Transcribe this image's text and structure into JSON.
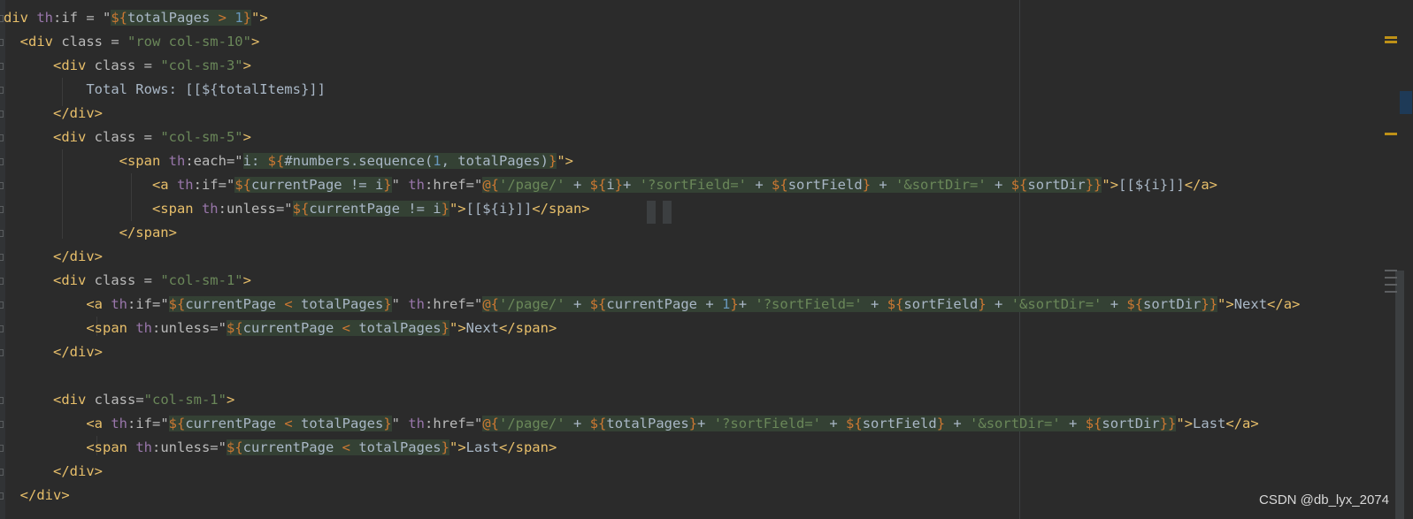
{
  "editor": {
    "lines": [
      [
        {
          "t": "div ",
          "c": "tag"
        },
        {
          "t": "th",
          "c": "ns"
        },
        {
          "t": ":if = \"",
          "c": "attr"
        },
        {
          "t": "${",
          "c": "expr",
          "h": 1
        },
        {
          "t": "totalPages ",
          "c": "txt",
          "h": 1
        },
        {
          "t": "> ",
          "c": "expr",
          "h": 1
        },
        {
          "t": "1",
          "c": "num",
          "h": 1
        },
        {
          "t": "}",
          "c": "expr",
          "h": 1
        },
        {
          "t": "\">",
          "c": "tag"
        }
      ],
      [
        {
          "t": "  <div ",
          "c": "tag"
        },
        {
          "t": "class = ",
          "c": "attr"
        },
        {
          "t": "\"row col-sm-10\"",
          "c": "str"
        },
        {
          "t": ">",
          "c": "tag"
        }
      ],
      [
        {
          "t": "      <div ",
          "c": "tag"
        },
        {
          "t": "class = ",
          "c": "attr"
        },
        {
          "t": "\"col-sm-3\"",
          "c": "str"
        },
        {
          "t": ">",
          "c": "tag"
        }
      ],
      [
        {
          "t": "          Total Rows: [[${totalItems}]]",
          "c": "txt"
        }
      ],
      [
        {
          "t": "      </div>",
          "c": "tag"
        }
      ],
      [
        {
          "t": "      <div ",
          "c": "tag"
        },
        {
          "t": "class = ",
          "c": "attr"
        },
        {
          "t": "\"col-sm-5\"",
          "c": "str"
        },
        {
          "t": ">",
          "c": "tag"
        }
      ],
      [
        {
          "t": "              <span ",
          "c": "tag"
        },
        {
          "t": "th",
          "c": "ns"
        },
        {
          "t": ":each=\"",
          "c": "attr"
        },
        {
          "t": "i: ",
          "c": "txt",
          "h": 1
        },
        {
          "t": "${",
          "c": "expr",
          "h": 1
        },
        {
          "t": "#numbers.sequence(",
          "c": "txt",
          "h": 1
        },
        {
          "t": "1",
          "c": "num",
          "h": 1
        },
        {
          "t": ", totalPages)",
          "c": "txt",
          "h": 1
        },
        {
          "t": "}",
          "c": "expr",
          "h": 1
        },
        {
          "t": "\">",
          "c": "tag"
        }
      ],
      [
        {
          "t": "                  <a ",
          "c": "tag"
        },
        {
          "t": "th",
          "c": "ns"
        },
        {
          "t": ":if=\"",
          "c": "attr"
        },
        {
          "t": "${",
          "c": "expr",
          "h": 1
        },
        {
          "t": "currentPage != i",
          "c": "txt",
          "h": 1
        },
        {
          "t": "}",
          "c": "expr",
          "h": 1
        },
        {
          "t": "\" ",
          "c": "attr"
        },
        {
          "t": "th",
          "c": "ns"
        },
        {
          "t": ":href=\"",
          "c": "attr"
        },
        {
          "t": "@{",
          "c": "expr",
          "h": 1
        },
        {
          "t": "'/page/' ",
          "c": "str",
          "h": 1
        },
        {
          "t": "+ ",
          "c": "txt",
          "h": 1
        },
        {
          "t": "${",
          "c": "expr",
          "h": 1
        },
        {
          "t": "i",
          "c": "txt",
          "h": 1
        },
        {
          "t": "}",
          "c": "expr",
          "h": 1
        },
        {
          "t": "+ ",
          "c": "txt",
          "h": 1
        },
        {
          "t": "'?sortField=' ",
          "c": "str",
          "h": 1
        },
        {
          "t": "+ ",
          "c": "txt",
          "h": 1
        },
        {
          "t": "${",
          "c": "expr",
          "h": 1
        },
        {
          "t": "sortField",
          "c": "txt",
          "h": 1
        },
        {
          "t": "} ",
          "c": "expr",
          "h": 1
        },
        {
          "t": "+ ",
          "c": "txt",
          "h": 1
        },
        {
          "t": "'&sortDir=' ",
          "c": "str",
          "h": 1
        },
        {
          "t": "+ ",
          "c": "txt",
          "h": 1
        },
        {
          "t": "${",
          "c": "expr",
          "h": 1
        },
        {
          "t": "sortDir",
          "c": "txt",
          "h": 1
        },
        {
          "t": "}}",
          "c": "expr",
          "h": 1
        },
        {
          "t": "\">",
          "c": "tag"
        },
        {
          "t": "[[${i}]]",
          "c": "txt"
        },
        {
          "t": "</a>",
          "c": "tag"
        }
      ],
      [
        {
          "t": "                  <span ",
          "c": "tag"
        },
        {
          "t": "th",
          "c": "ns"
        },
        {
          "t": ":unless=\"",
          "c": "attr"
        },
        {
          "t": "${",
          "c": "expr",
          "h": 1
        },
        {
          "t": "currentPage != i",
          "c": "txt",
          "h": 1
        },
        {
          "t": "}",
          "c": "expr",
          "h": 1
        },
        {
          "t": "\">",
          "c": "tag"
        },
        {
          "t": "[[${i}]]",
          "c": "txt"
        },
        {
          "t": "</span>",
          "c": "tag"
        }
      ],
      [
        {
          "t": "              </span>",
          "c": "tag"
        }
      ],
      [
        {
          "t": "      </div>",
          "c": "tag"
        }
      ],
      [
        {
          "t": "      <div ",
          "c": "tag"
        },
        {
          "t": "class = ",
          "c": "attr"
        },
        {
          "t": "\"col-sm-1\"",
          "c": "str"
        },
        {
          "t": ">",
          "c": "tag"
        }
      ],
      [
        {
          "t": "          <a ",
          "c": "tag"
        },
        {
          "t": "th",
          "c": "ns"
        },
        {
          "t": ":if=\"",
          "c": "attr"
        },
        {
          "t": "${",
          "c": "expr",
          "h": 1
        },
        {
          "t": "currentPage ",
          "c": "txt",
          "h": 1
        },
        {
          "t": "< ",
          "c": "expr",
          "h": 1
        },
        {
          "t": "totalPages",
          "c": "txt",
          "h": 1
        },
        {
          "t": "}",
          "c": "expr",
          "h": 1
        },
        {
          "t": "\" ",
          "c": "attr"
        },
        {
          "t": "th",
          "c": "ns"
        },
        {
          "t": ":href=\"",
          "c": "attr"
        },
        {
          "t": "@{",
          "c": "expr",
          "h": 1
        },
        {
          "t": "'/page/' ",
          "c": "str",
          "h": 1
        },
        {
          "t": "+ ",
          "c": "txt",
          "h": 1
        },
        {
          "t": "${",
          "c": "expr",
          "h": 1
        },
        {
          "t": "currentPage ",
          "c": "txt",
          "h": 1
        },
        {
          "t": "+ ",
          "c": "txt",
          "h": 1
        },
        {
          "t": "1",
          "c": "num",
          "h": 1
        },
        {
          "t": "}",
          "c": "expr",
          "h": 1
        },
        {
          "t": "+ ",
          "c": "txt",
          "h": 1
        },
        {
          "t": "'?sortField=' ",
          "c": "str",
          "h": 1
        },
        {
          "t": "+ ",
          "c": "txt",
          "h": 1
        },
        {
          "t": "${",
          "c": "expr",
          "h": 1
        },
        {
          "t": "sortField",
          "c": "txt",
          "h": 1
        },
        {
          "t": "} ",
          "c": "expr",
          "h": 1
        },
        {
          "t": "+ ",
          "c": "txt",
          "h": 1
        },
        {
          "t": "'&sortDir=' ",
          "c": "str",
          "h": 1
        },
        {
          "t": "+ ",
          "c": "txt",
          "h": 1
        },
        {
          "t": "${",
          "c": "expr",
          "h": 1
        },
        {
          "t": "sortDir",
          "c": "txt",
          "h": 1
        },
        {
          "t": "}}",
          "c": "expr",
          "h": 1
        },
        {
          "t": "\">",
          "c": "tag"
        },
        {
          "t": "Next",
          "c": "txt"
        },
        {
          "t": "</a>",
          "c": "tag"
        }
      ],
      [
        {
          "t": "          <span ",
          "c": "tag"
        },
        {
          "t": "th",
          "c": "ns"
        },
        {
          "t": ":unless=\"",
          "c": "attr"
        },
        {
          "t": "${",
          "c": "expr",
          "h": 1
        },
        {
          "t": "currentPage ",
          "c": "txt",
          "h": 1
        },
        {
          "t": "< ",
          "c": "expr",
          "h": 1
        },
        {
          "t": "totalPages",
          "c": "txt",
          "h": 1
        },
        {
          "t": "}",
          "c": "expr",
          "h": 1
        },
        {
          "t": "\">",
          "c": "tag"
        },
        {
          "t": "Next",
          "c": "txt"
        },
        {
          "t": "</span>",
          "c": "tag"
        }
      ],
      [
        {
          "t": "      </div>",
          "c": "tag"
        }
      ],
      [],
      [
        {
          "t": "      <div ",
          "c": "tag"
        },
        {
          "t": "class=",
          "c": "attr"
        },
        {
          "t": "\"col-sm-1\"",
          "c": "str"
        },
        {
          "t": ">",
          "c": "tag"
        }
      ],
      [
        {
          "t": "          <a ",
          "c": "tag"
        },
        {
          "t": "th",
          "c": "ns"
        },
        {
          "t": ":if=\"",
          "c": "attr"
        },
        {
          "t": "${",
          "c": "expr",
          "h": 1
        },
        {
          "t": "currentPage ",
          "c": "txt",
          "h": 1
        },
        {
          "t": "< ",
          "c": "expr",
          "h": 1
        },
        {
          "t": "totalPages",
          "c": "txt",
          "h": 1
        },
        {
          "t": "}",
          "c": "expr",
          "h": 1
        },
        {
          "t": "\" ",
          "c": "attr"
        },
        {
          "t": "th",
          "c": "ns"
        },
        {
          "t": ":href=\"",
          "c": "attr"
        },
        {
          "t": "@{",
          "c": "expr",
          "h": 1
        },
        {
          "t": "'/page/' ",
          "c": "str",
          "h": 1
        },
        {
          "t": "+ ",
          "c": "txt",
          "h": 1
        },
        {
          "t": "${",
          "c": "expr",
          "h": 1
        },
        {
          "t": "totalPages",
          "c": "txt",
          "h": 1
        },
        {
          "t": "}",
          "c": "expr",
          "h": 1
        },
        {
          "t": "+ ",
          "c": "txt",
          "h": 1
        },
        {
          "t": "'?sortField=' ",
          "c": "str",
          "h": 1
        },
        {
          "t": "+ ",
          "c": "txt",
          "h": 1
        },
        {
          "t": "${",
          "c": "expr",
          "h": 1
        },
        {
          "t": "sortField",
          "c": "txt",
          "h": 1
        },
        {
          "t": "} ",
          "c": "expr",
          "h": 1
        },
        {
          "t": "+ ",
          "c": "txt",
          "h": 1
        },
        {
          "t": "'&sortDir=' ",
          "c": "str",
          "h": 1
        },
        {
          "t": "+ ",
          "c": "txt",
          "h": 1
        },
        {
          "t": "${",
          "c": "expr",
          "h": 1
        },
        {
          "t": "sortDir",
          "c": "txt",
          "h": 1
        },
        {
          "t": "}}",
          "c": "expr",
          "h": 1
        },
        {
          "t": "\">",
          "c": "tag"
        },
        {
          "t": "Last",
          "c": "txt"
        },
        {
          "t": "</a>",
          "c": "tag"
        }
      ],
      [
        {
          "t": "          <span ",
          "c": "tag"
        },
        {
          "t": "th",
          "c": "ns"
        },
        {
          "t": ":unless=\"",
          "c": "attr"
        },
        {
          "t": "${",
          "c": "expr",
          "h": 1
        },
        {
          "t": "currentPage ",
          "c": "txt",
          "h": 1
        },
        {
          "t": "< ",
          "c": "expr",
          "h": 1
        },
        {
          "t": "totalPages",
          "c": "txt",
          "h": 1
        },
        {
          "t": "}",
          "c": "expr",
          "h": 1
        },
        {
          "t": "\">",
          "c": "tag"
        },
        {
          "t": "Last",
          "c": "txt"
        },
        {
          "t": "</span>",
          "c": "tag"
        }
      ],
      [
        {
          "t": "      </div>",
          "c": "tag"
        }
      ],
      [
        {
          "t": "  </div>",
          "c": "tag"
        }
      ]
    ]
  },
  "watermark": "CSDN @db_lyx_2074",
  "colors": {
    "background": "#2b2b2b",
    "tag": "#e8bf6a",
    "string": "#6a8759",
    "namespace": "#9876aa",
    "expression": "#cc7832",
    "number": "#6897bb",
    "text": "#a9b7c6",
    "highlight": "#344134",
    "warning_marker": "#be9117"
  }
}
